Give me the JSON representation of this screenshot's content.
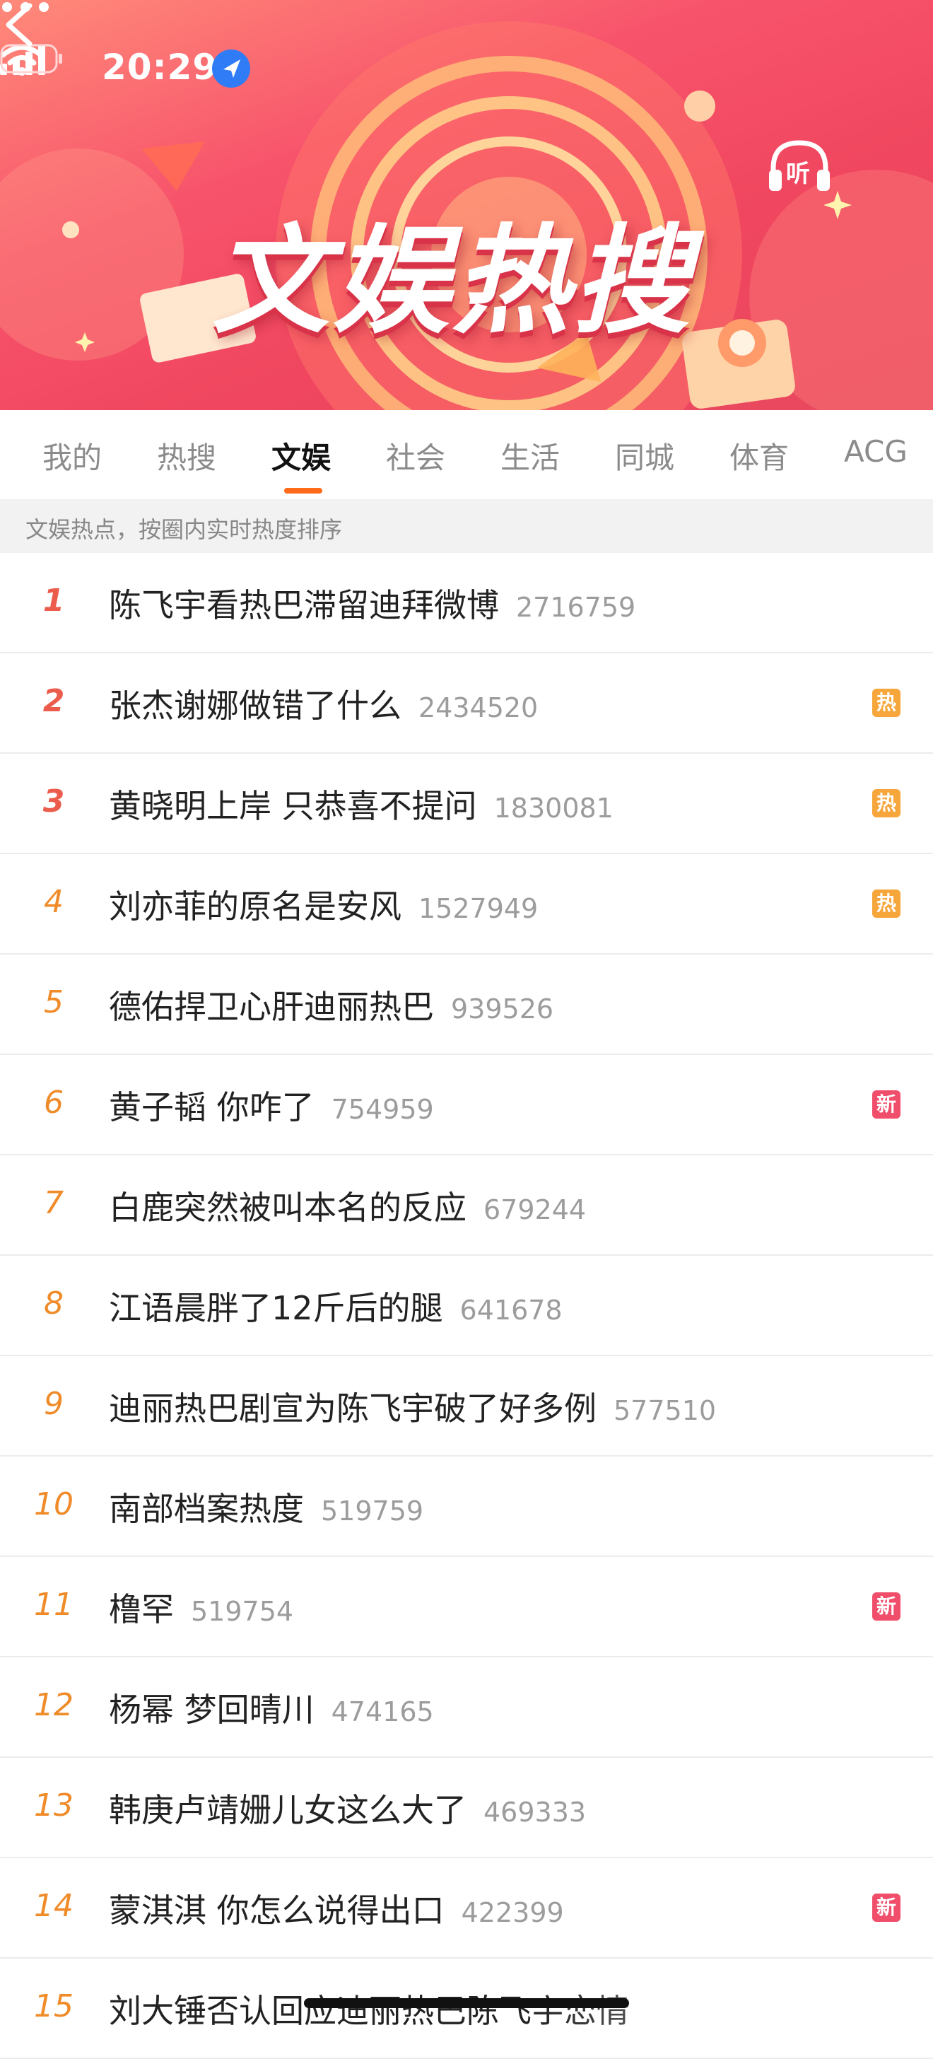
{
  "status_bar": {
    "time": "20:29"
  },
  "banner": {
    "title": "文娱热搜",
    "listen_label": "听"
  },
  "tabs": [
    {
      "label": "我的",
      "active": false
    },
    {
      "label": "热搜",
      "active": false
    },
    {
      "label": "文娱",
      "active": true
    },
    {
      "label": "社会",
      "active": false
    },
    {
      "label": "生活",
      "active": false
    },
    {
      "label": "同城",
      "active": false
    },
    {
      "label": "体育",
      "active": false
    },
    {
      "label": "ACG",
      "active": false
    }
  ],
  "subheader": "文娱热点，按圈内实时热度排序",
  "colors": {
    "accent": "#ff6a1a",
    "hot_badge": "#f6a63a",
    "new_badge": "#f04e6a",
    "rank_top": "#ec5c4c",
    "rank": "#f08b2a"
  },
  "items": [
    {
      "rank": "1",
      "title": "陈飞宇看热巴滞留迪拜微博",
      "heat": "2716759",
      "badge": ""
    },
    {
      "rank": "2",
      "title": "张杰谢娜做错了什么",
      "heat": "2434520",
      "badge": "热"
    },
    {
      "rank": "3",
      "title": "黄晓明上岸 只恭喜不提问",
      "heat": "1830081",
      "badge": "热"
    },
    {
      "rank": "4",
      "title": "刘亦菲的原名是安风",
      "heat": "1527949",
      "badge": "热"
    },
    {
      "rank": "5",
      "title": "德佑捍卫心肝迪丽热巴",
      "heat": "939526",
      "badge": ""
    },
    {
      "rank": "6",
      "title": "黄子韬 你咋了",
      "heat": "754959",
      "badge": "新"
    },
    {
      "rank": "7",
      "title": "白鹿突然被叫本名的反应",
      "heat": "679244",
      "badge": ""
    },
    {
      "rank": "8",
      "title": "江语晨胖了12斤后的腿",
      "heat": "641678",
      "badge": ""
    },
    {
      "rank": "9",
      "title": "迪丽热巴剧宣为陈飞宇破了好多例",
      "heat": "577510",
      "badge": ""
    },
    {
      "rank": "10",
      "title": "南部档案热度",
      "heat": "519759",
      "badge": ""
    },
    {
      "rank": "11",
      "title": "橹罕",
      "heat": "519754",
      "badge": "新"
    },
    {
      "rank": "12",
      "title": "杨幂 梦回晴川",
      "heat": "474165",
      "badge": ""
    },
    {
      "rank": "13",
      "title": "韩庚卢靖姗儿女这么大了",
      "heat": "469333",
      "badge": ""
    },
    {
      "rank": "14",
      "title": "蒙淇淇 你怎么说得出口",
      "heat": "422399",
      "badge": "新"
    },
    {
      "rank": "15",
      "title": "刘大锤否认回应迪丽热巴陈飞宇恋情",
      "heat": "",
      "badge": ""
    }
  ]
}
